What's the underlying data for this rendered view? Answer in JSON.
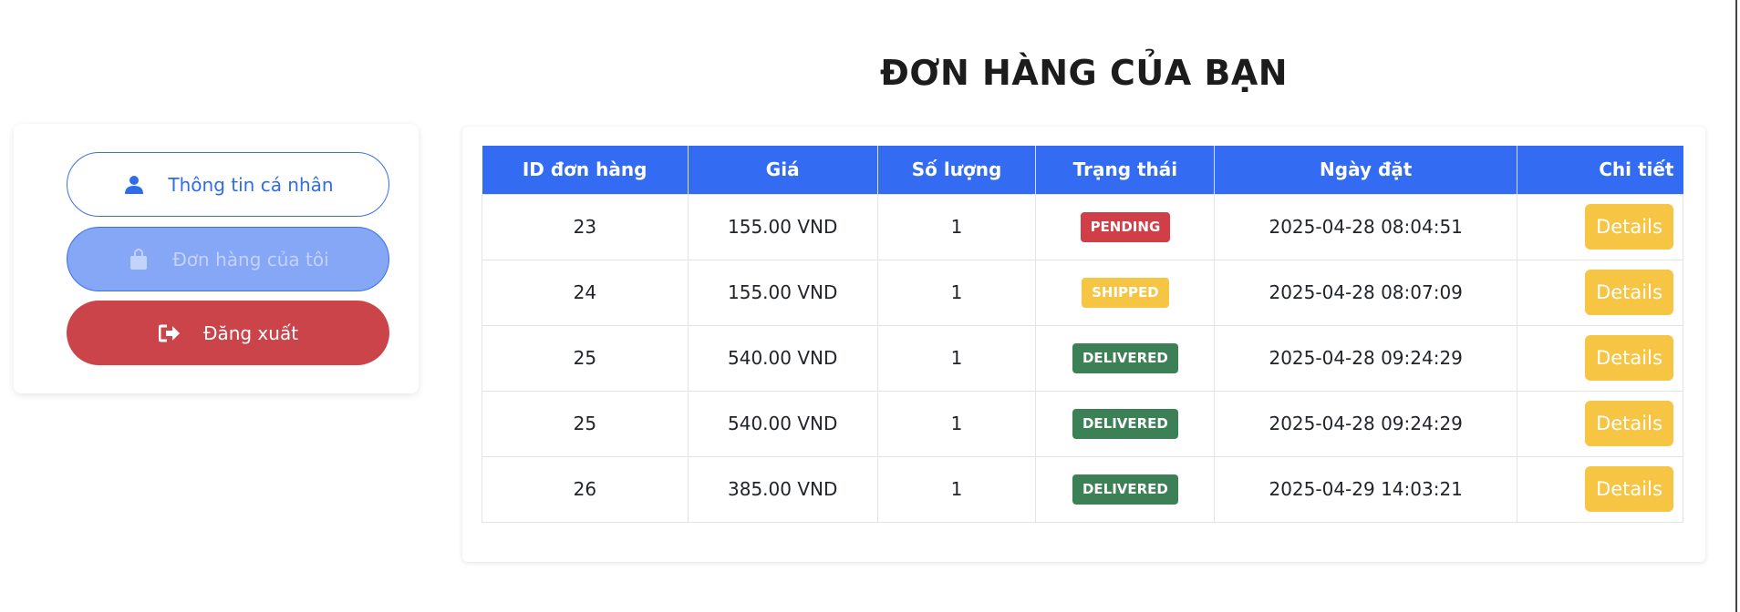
{
  "sidebar": {
    "profile_label": "Thông tin cá nhân",
    "orders_label": "Đơn hàng của tôi",
    "logout_label": "Đăng xuất",
    "icons": {
      "profile": "user-icon",
      "orders": "shopping-bag-icon",
      "logout": "sign-out-icon"
    }
  },
  "page": {
    "title": "ĐƠN HÀNG CỦA BẠN"
  },
  "table": {
    "headers": [
      "ID đơn hàng",
      "Giá",
      "Số lượng",
      "Trạng thái",
      "Ngày đặt",
      "Chi tiết"
    ],
    "rows": [
      {
        "id": "23",
        "price": "155.00 VND",
        "qty": "1",
        "status": "PENDING",
        "date": "2025-04-28 08:04:51",
        "action": "Details"
      },
      {
        "id": "24",
        "price": "155.00 VND",
        "qty": "1",
        "status": "SHIPPED",
        "date": "2025-04-28 08:07:09",
        "action": "Details"
      },
      {
        "id": "25",
        "price": "540.00 VND",
        "qty": "1",
        "status": "DELIVERED",
        "date": "2025-04-28 09:24:29",
        "action": "Details"
      },
      {
        "id": "25",
        "price": "540.00 VND",
        "qty": "1",
        "status": "DELIVERED",
        "date": "2025-04-28 09:24:29",
        "action": "Details"
      },
      {
        "id": "26",
        "price": "385.00 VND",
        "qty": "1",
        "status": "DELIVERED",
        "date": "2025-04-29 14:03:21",
        "action": "Details"
      }
    ]
  },
  "colors": {
    "primary": "#336cf2",
    "danger": "#cb444a",
    "warning": "#f5c543",
    "success": "#3c8055"
  }
}
